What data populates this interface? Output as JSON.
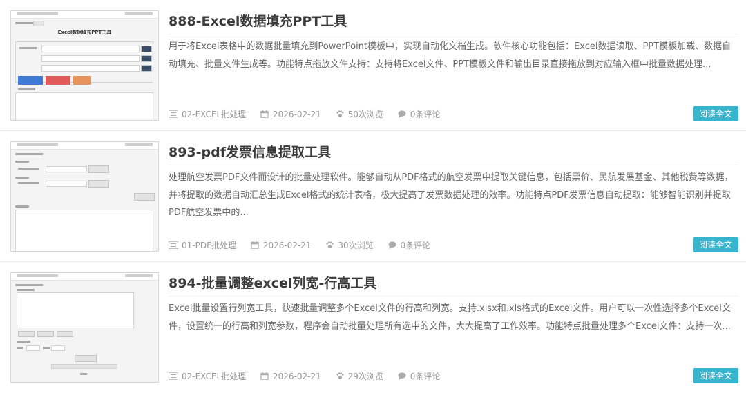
{
  "posts": [
    {
      "title": "888-Excel数据填充PPT工具",
      "description": "用于将Excel表格中的数据批量填充到PowerPoint模板中，实现自动化文档生成。软件核心功能包括：Excel数据读取、PPT模板加载、数据自动填充、批量文件生成等。功能特点拖放文件支持：支持将Excel文件、PPT模板文件和输出目录直接拖放到对应输入框中批量数据处理...",
      "category": "02-EXCEL批处理",
      "date": "2026-02-21",
      "views": "50次浏览",
      "comments": "0条评论",
      "read_more": "阅读全文"
    },
    {
      "title": "893-pdf发票信息提取工具",
      "description": "处理航空发票PDF文件而设计的批量处理软件。能够自动从PDF格式的航空发票中提取关键信息，包括票价、民航发展基金、其他税费等数据，并将提取的数据自动汇总生成Excel格式的统计表格，极大提高了发票数据处理的效率。功能特点PDF发票信息自动提取：能够智能识别并提取PDF航空发票中的...",
      "category": "01-PDF批处理",
      "date": "2026-02-21",
      "views": "30次浏览",
      "comments": "0条评论",
      "read_more": "阅读全文"
    },
    {
      "title": "894-批量调整excel列宽-行高工具",
      "description": "Excel批量设置行列宽工具，快速批量调整多个Excel文件的行高和列宽。支持.xlsx和.xls格式的Excel文件。用户可以一次性选择多个Excel文件，设置统一的行高和列宽参数，程序会自动批量处理所有选中的文件，大大提高了工作效率。功能特点批量处理多个Excel文件：支持一次...",
      "category": "02-EXCEL批处理",
      "date": "2026-02-21",
      "views": "29次浏览",
      "comments": "0条评论",
      "read_more": "阅读全文"
    }
  ],
  "thumbs": [
    {
      "window_title": "Excel数据填充PPT工具",
      "heading": "Excel数据填充PPT工具"
    },
    {
      "window_title": "",
      "heading": ""
    },
    {
      "window_title": "",
      "heading": ""
    }
  ],
  "icons": {
    "category": "list-icon",
    "date": "calendar-icon",
    "views": "paw-icon",
    "comments": "comment-icon"
  },
  "colors": {
    "accent": "#37b4ce",
    "title": "#3a3a3a",
    "meta": "#999999"
  }
}
